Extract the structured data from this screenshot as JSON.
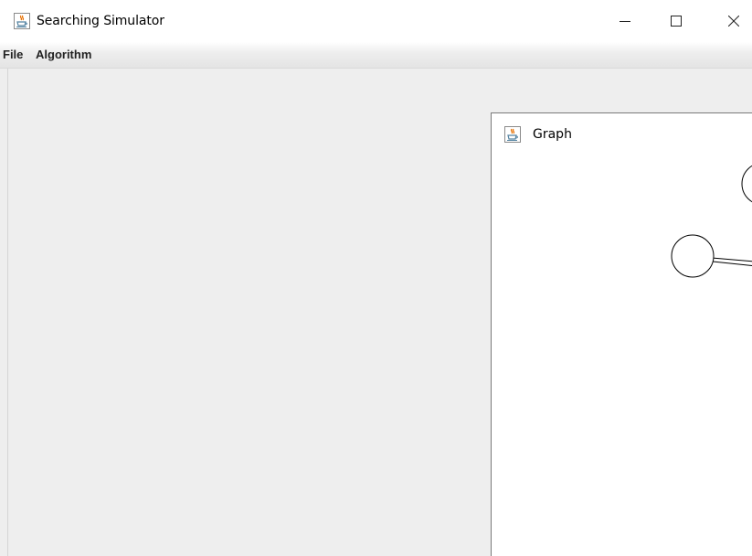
{
  "window": {
    "title": "Searching Simulator",
    "icon": "java-cup-icon",
    "controls": [
      "minimize-icon",
      "maximize-icon",
      "close-icon"
    ]
  },
  "menubar": {
    "items": [
      {
        "label": "File"
      },
      {
        "label": "Algorithm"
      }
    ]
  },
  "graph_frame": {
    "title": "Graph",
    "icon": "java-cup-icon"
  },
  "colors": {
    "titlebar_bg": "#ffffff",
    "desktop_bg": "#eeeeee",
    "canvas_bg": "#ffffff",
    "node_stroke": "#000000",
    "java_icon_red": "#e76f00",
    "java_icon_blue": "#5382a1"
  }
}
